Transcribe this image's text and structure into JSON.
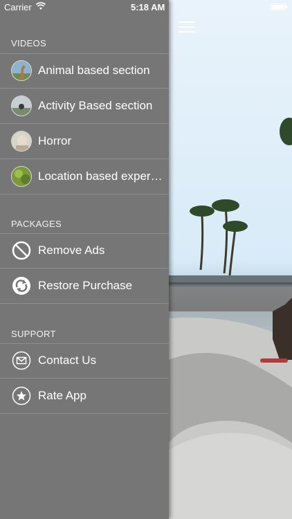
{
  "status_bar": {
    "carrier": "Carrier",
    "time": "5:18 AM"
  },
  "drawer": {
    "videos_header": "VIDEOS",
    "videos": [
      {
        "label": "Animal based section",
        "icon": "giraffe-thumbnail"
      },
      {
        "label": "Activity Based section",
        "icon": "activity-thumbnail"
      },
      {
        "label": "Horror",
        "icon": "horror-thumbnail"
      },
      {
        "label": "Location based experiences",
        "icon": "location-thumbnail"
      }
    ],
    "packages_header": "PACKAGES",
    "packages": [
      {
        "label": "Remove Ads",
        "icon": "no-ads-icon"
      },
      {
        "label": "Restore Purchase",
        "icon": "restore-icon"
      }
    ],
    "support_header": "SUPPORT",
    "support": [
      {
        "label": "Contact Us",
        "icon": "mail-icon"
      },
      {
        "label": "Rate App",
        "icon": "star-icon"
      }
    ]
  },
  "colors": {
    "drawer_bg": "#767676",
    "divider": "#8e8e8e",
    "text": "#ffffff"
  }
}
